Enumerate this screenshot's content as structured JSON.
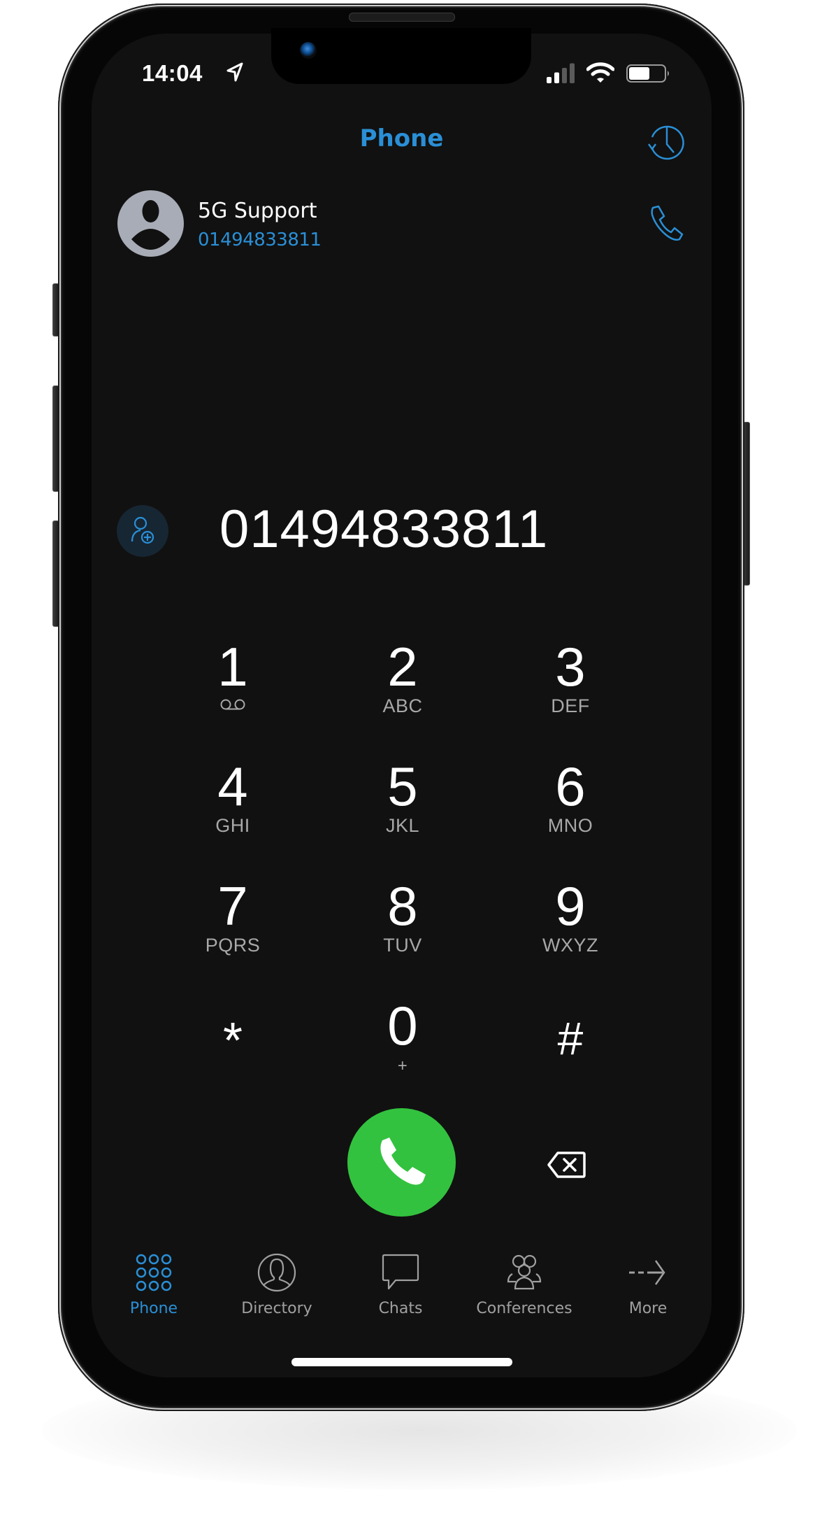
{
  "status_bar": {
    "time": "14:04",
    "location_icon": "location-arrow-icon",
    "signal_bars_active": 2,
    "signal_bars_total": 4,
    "wifi_icon": "wifi-icon",
    "battery_level": 0.6
  },
  "header": {
    "title": "Phone",
    "history_icon": "call-history-icon"
  },
  "recent_contact": {
    "name": "5G Support",
    "number": "01494833811",
    "avatar_icon": "person-avatar-icon",
    "call_icon": "phone-icon"
  },
  "dialer": {
    "dialed_number": "01494833811",
    "add_contact_icon": "add-contact-icon",
    "keys": [
      {
        "digit": "1",
        "letters": "",
        "sub_icon": "voicemail-icon"
      },
      {
        "digit": "2",
        "letters": "ABC"
      },
      {
        "digit": "3",
        "letters": "DEF"
      },
      {
        "digit": "4",
        "letters": "GHI"
      },
      {
        "digit": "5",
        "letters": "JKL"
      },
      {
        "digit": "6",
        "letters": "MNO"
      },
      {
        "digit": "7",
        "letters": "PQRS"
      },
      {
        "digit": "8",
        "letters": "TUV"
      },
      {
        "digit": "9",
        "letters": "WXYZ"
      },
      {
        "digit": "*",
        "letters": ""
      },
      {
        "digit": "0",
        "letters": "+"
      },
      {
        "digit": "#",
        "letters": ""
      }
    ],
    "call_button_icon": "phone-handset-icon",
    "backspace_icon": "backspace-icon"
  },
  "tabs": [
    {
      "label": "Phone",
      "icon": "keypad-icon",
      "active": true
    },
    {
      "label": "Directory",
      "icon": "person-circle-icon",
      "active": false
    },
    {
      "label": "Chats",
      "icon": "chat-bubble-icon",
      "active": false
    },
    {
      "label": "Conferences",
      "icon": "group-icon",
      "active": false
    },
    {
      "label": "More",
      "icon": "arrow-right-icon",
      "active": false
    }
  ],
  "colors": {
    "accent": "#2a8fd6",
    "call_green": "#33c23f",
    "background": "#111111",
    "secondary_text": "#a0a0a0"
  }
}
